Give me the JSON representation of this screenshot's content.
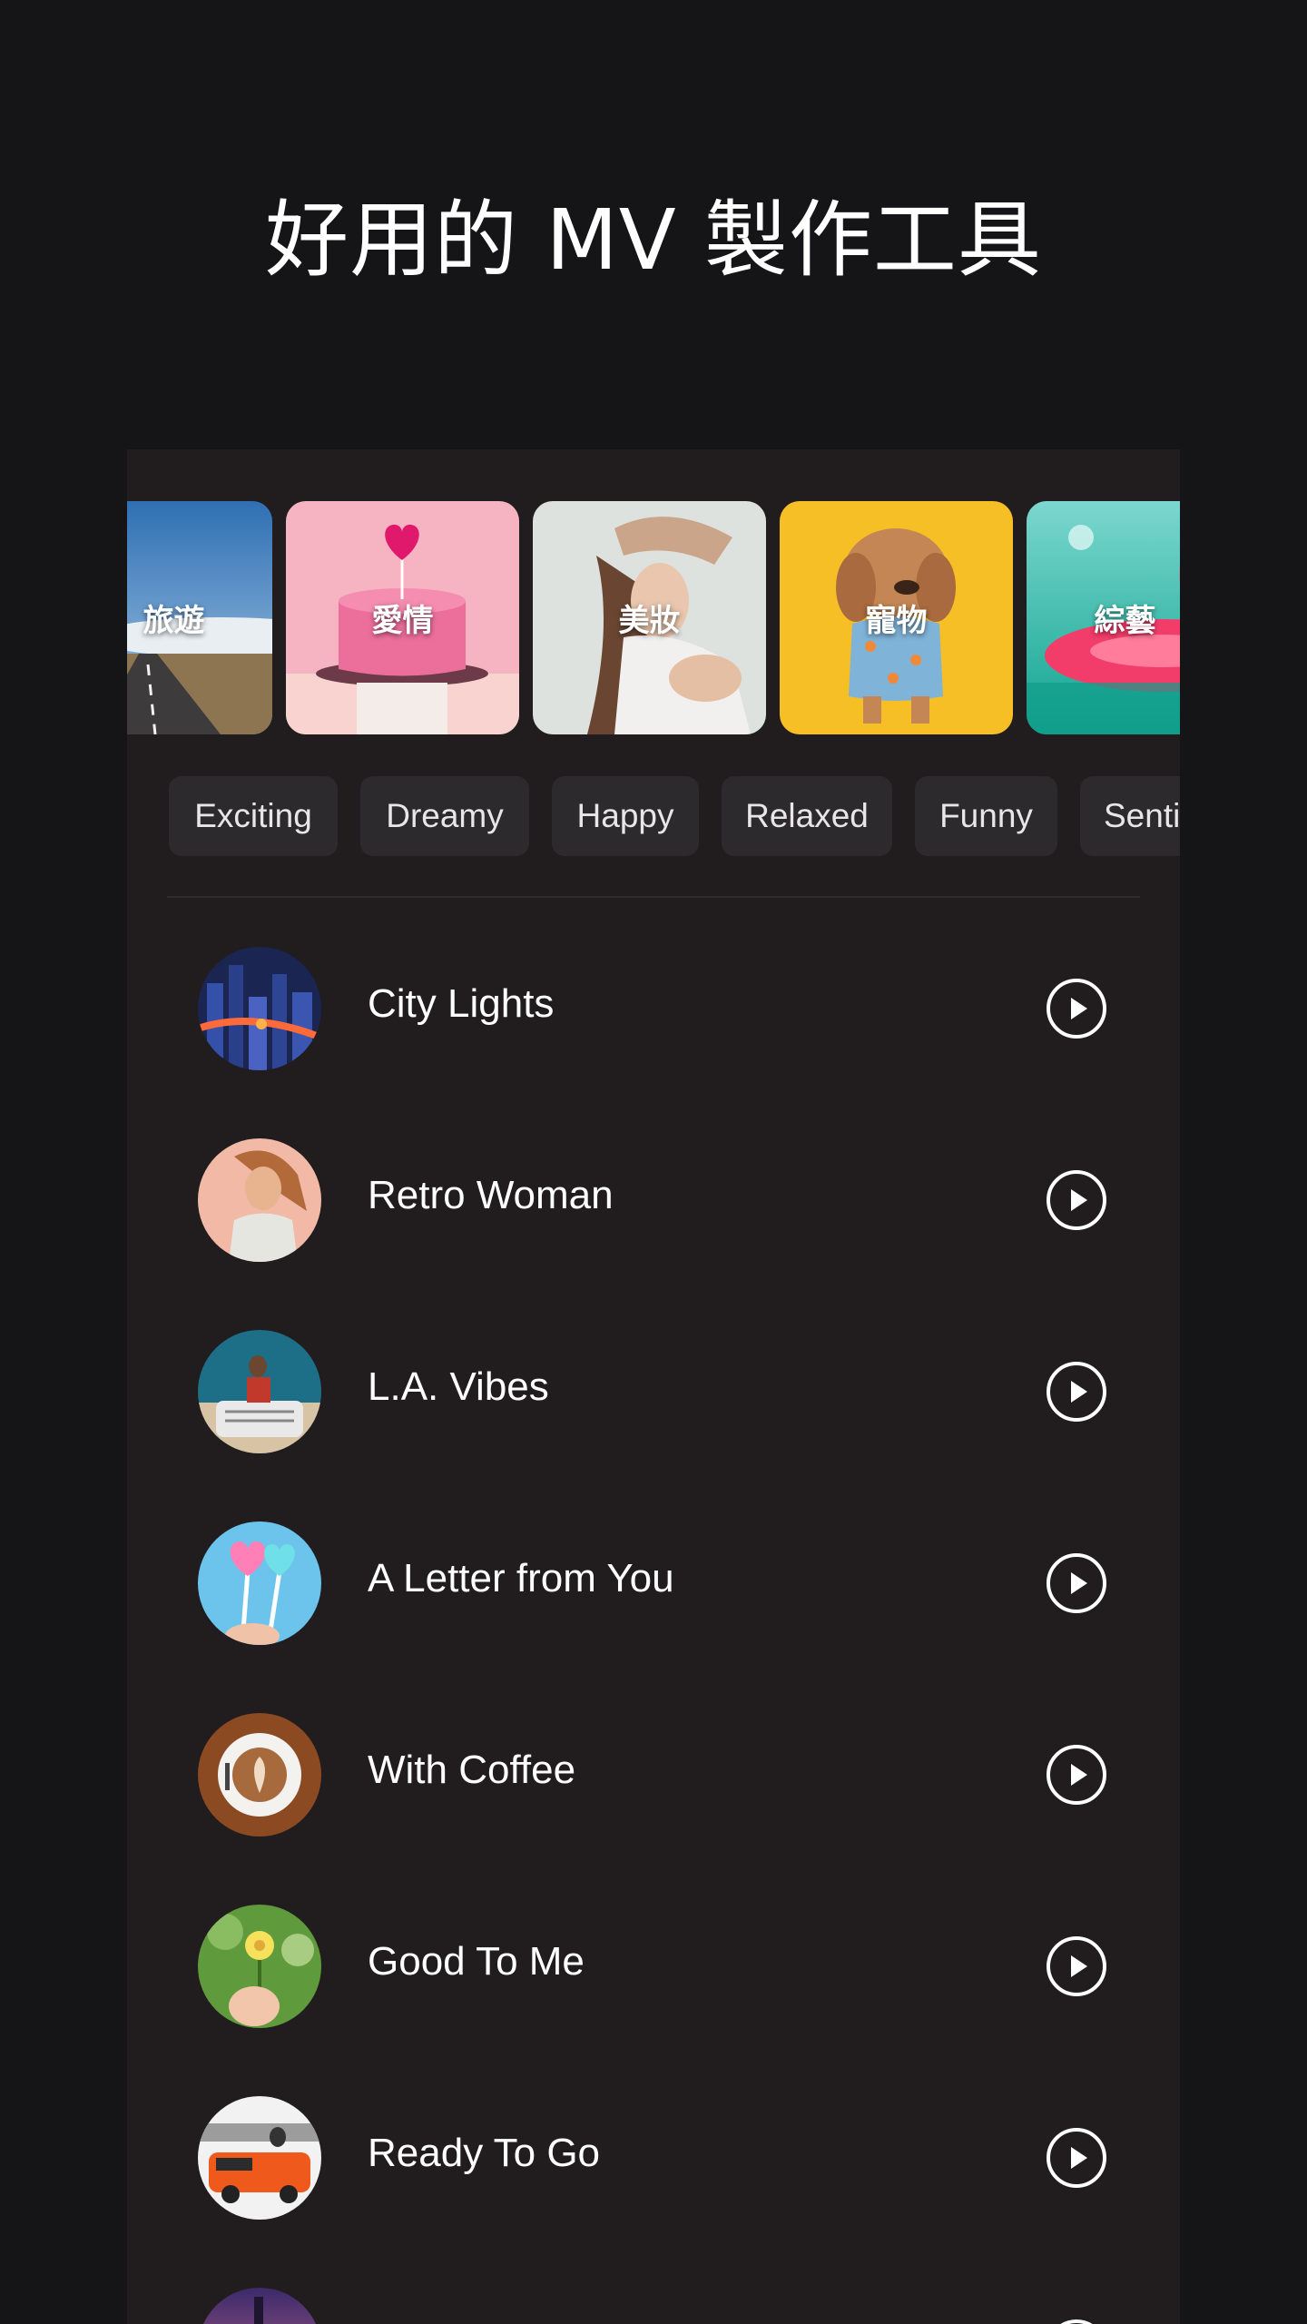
{
  "headline": "好用的 MV 製作工具",
  "categories": [
    {
      "label": "旅遊",
      "icon": "road-photo"
    },
    {
      "label": "愛情",
      "icon": "cake-photo"
    },
    {
      "label": "美妝",
      "icon": "woman-photo"
    },
    {
      "label": "寵物",
      "icon": "dog-photo"
    },
    {
      "label": "綜藝",
      "icon": "flamingo-float-photo"
    }
  ],
  "moods": [
    "Exciting",
    "Dreamy",
    "Happy",
    "Relaxed",
    "Funny",
    "Senti"
  ],
  "songs": [
    {
      "title": "City Lights",
      "icon": "city-night-thumb"
    },
    {
      "title": "Retro Woman",
      "icon": "woman-portrait-thumb"
    },
    {
      "title": "L.A. Vibes",
      "icon": "man-on-car-thumb"
    },
    {
      "title": "A Letter from You",
      "icon": "heart-lollipop-thumb"
    },
    {
      "title": "With Coffee",
      "icon": "latte-thumb"
    },
    {
      "title": "Good To Me",
      "icon": "flower-hand-thumb"
    },
    {
      "title": "Ready To Go",
      "icon": "orange-van-thumb"
    },
    {
      "title": "",
      "icon": "sunset-city-thumb"
    }
  ],
  "colors": {
    "background": "#151416",
    "panel": "#211d1f",
    "chip": "#2d2a2d"
  }
}
